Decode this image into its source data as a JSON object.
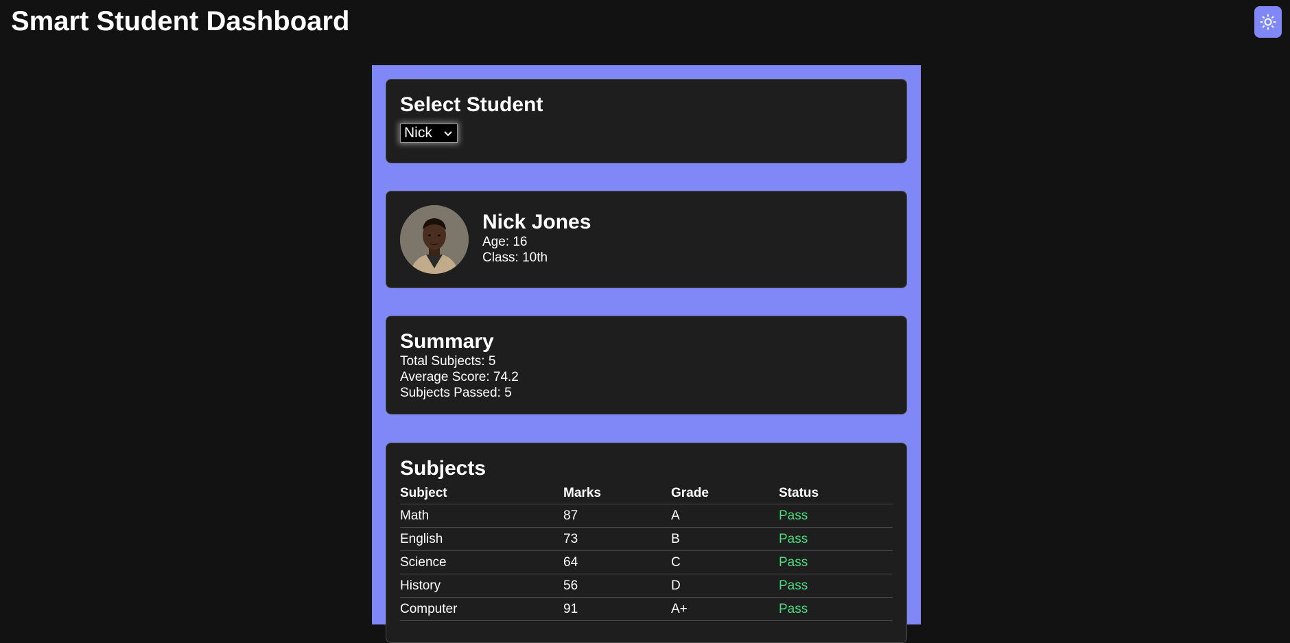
{
  "header": {
    "title": "Smart Student Dashboard",
    "theme_icon": "sun-icon"
  },
  "select_card": {
    "heading": "Select Student",
    "selected": "Nick"
  },
  "profile": {
    "name": "Nick Jones",
    "age_line": "Age: 16",
    "class_line": "Class: 10th"
  },
  "summary": {
    "heading": "Summary",
    "total_subjects": "Total Subjects: 5",
    "average_score": "Average Score: 74.2",
    "subjects_passed": "Subjects Passed: 5"
  },
  "subjects": {
    "heading": "Subjects",
    "columns": [
      "Subject",
      "Marks",
      "Grade",
      "Status"
    ],
    "rows": [
      {
        "subject": "Math",
        "marks": "87",
        "grade": "A",
        "status": "Pass"
      },
      {
        "subject": "English",
        "marks": "73",
        "grade": "B",
        "status": "Pass"
      },
      {
        "subject": "Science",
        "marks": "64",
        "grade": "C",
        "status": "Pass"
      },
      {
        "subject": "History",
        "marks": "56",
        "grade": "D",
        "status": "Pass"
      },
      {
        "subject": "Computer",
        "marks": "91",
        "grade": "A+",
        "status": "Pass"
      }
    ]
  },
  "colors": {
    "accent": "#8088f8",
    "background": "#121212",
    "card": "#1e1e1e",
    "pass": "#4ade80"
  }
}
